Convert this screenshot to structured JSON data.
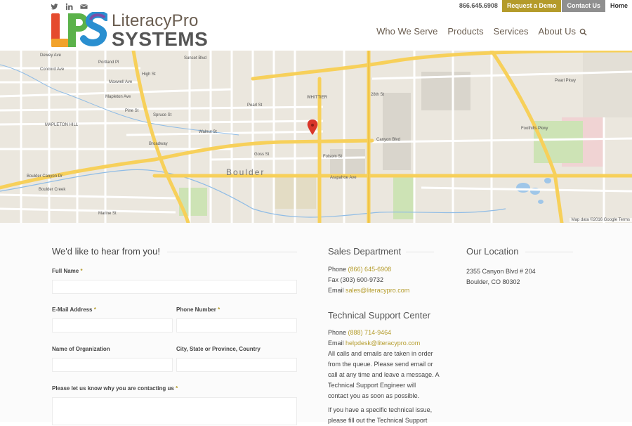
{
  "header": {
    "social": [
      "twitter-icon",
      "linkedin-icon",
      "mail-icon"
    ],
    "phone": "866.645.6908",
    "request_demo": "Request a Demo",
    "contact_us": "Contact Us",
    "home": "Home",
    "logo_line1": "LiteracyPro",
    "logo_line2": "SYSTEMS",
    "nav": [
      "Who We Serve",
      "Products",
      "Services",
      "About Us"
    ]
  },
  "map": {
    "town": "Boulder",
    "credit": "Map data ©2016 Google   Terms",
    "labels": {
      "l1": "Dewey Ave",
      "l2": "Concord Ave",
      "l3": "Portland Pl",
      "l4": "Maxwell Ave",
      "l5": "Mapleton Ave",
      "l6": "Pine St",
      "l7": "Spruce St",
      "l8": "Pearl St",
      "l9": "Walnut St",
      "l10": "Canyon Blvd",
      "l11": "Arapahoe Ave",
      "l12": "Marine St",
      "l13": "Boulder Canyon Dr",
      "l14": "Boulder Creek",
      "l15": "Pearl Pkwy",
      "l16": "Foothills Pkwy",
      "l17": "28th St",
      "l18": "Folsom St",
      "l19": "Broadway",
      "l20": "WHITTIER",
      "l21": "MAPLETON HILL",
      "l22": "Goss St",
      "l23": "Sunset Blvd",
      "l24": "High St"
    }
  },
  "form": {
    "title": "We'd like to hear from you!",
    "full_name": "Full Name",
    "email": "E-Mail Address",
    "phone": "Phone Number",
    "org": "Name of Organization",
    "city": "City, State or Province, Country",
    "why": "Please let us know why you are contacting us",
    "required_mark": "*"
  },
  "sales": {
    "title": "Sales Department",
    "phone_label": "Phone",
    "phone": "(866) 645-6908",
    "fax": "Fax (303) 600-9732",
    "email_label": "Email",
    "email": "sales@literacypro.com"
  },
  "support": {
    "title": "Technical Support Center",
    "phone_label": "Phone",
    "phone": "(888) 714-9464",
    "email_label": "Email",
    "email": "helpdesk@literacypro.com",
    "para1_l1": "All calls and emails are taken in order",
    "para1_l2": "from the queue. Please send email or",
    "para1_l3": "call at any time and leave a message. A",
    "para1_l4": "Technical Support Engineer will",
    "para1_l5": "contact you as soon as possible.",
    "para2_l1": "If you have a specific technical issue,",
    "para2_l2": "please fill out the Technical Support"
  },
  "location": {
    "title": "Our Location",
    "line1": "2355 Canyon Blvd # 204",
    "line2": "Boulder, CO 80302"
  },
  "colors": {
    "accent": "#b49b2a",
    "gray_button": "#8f8f8f",
    "road_major": "#f7d05a"
  }
}
